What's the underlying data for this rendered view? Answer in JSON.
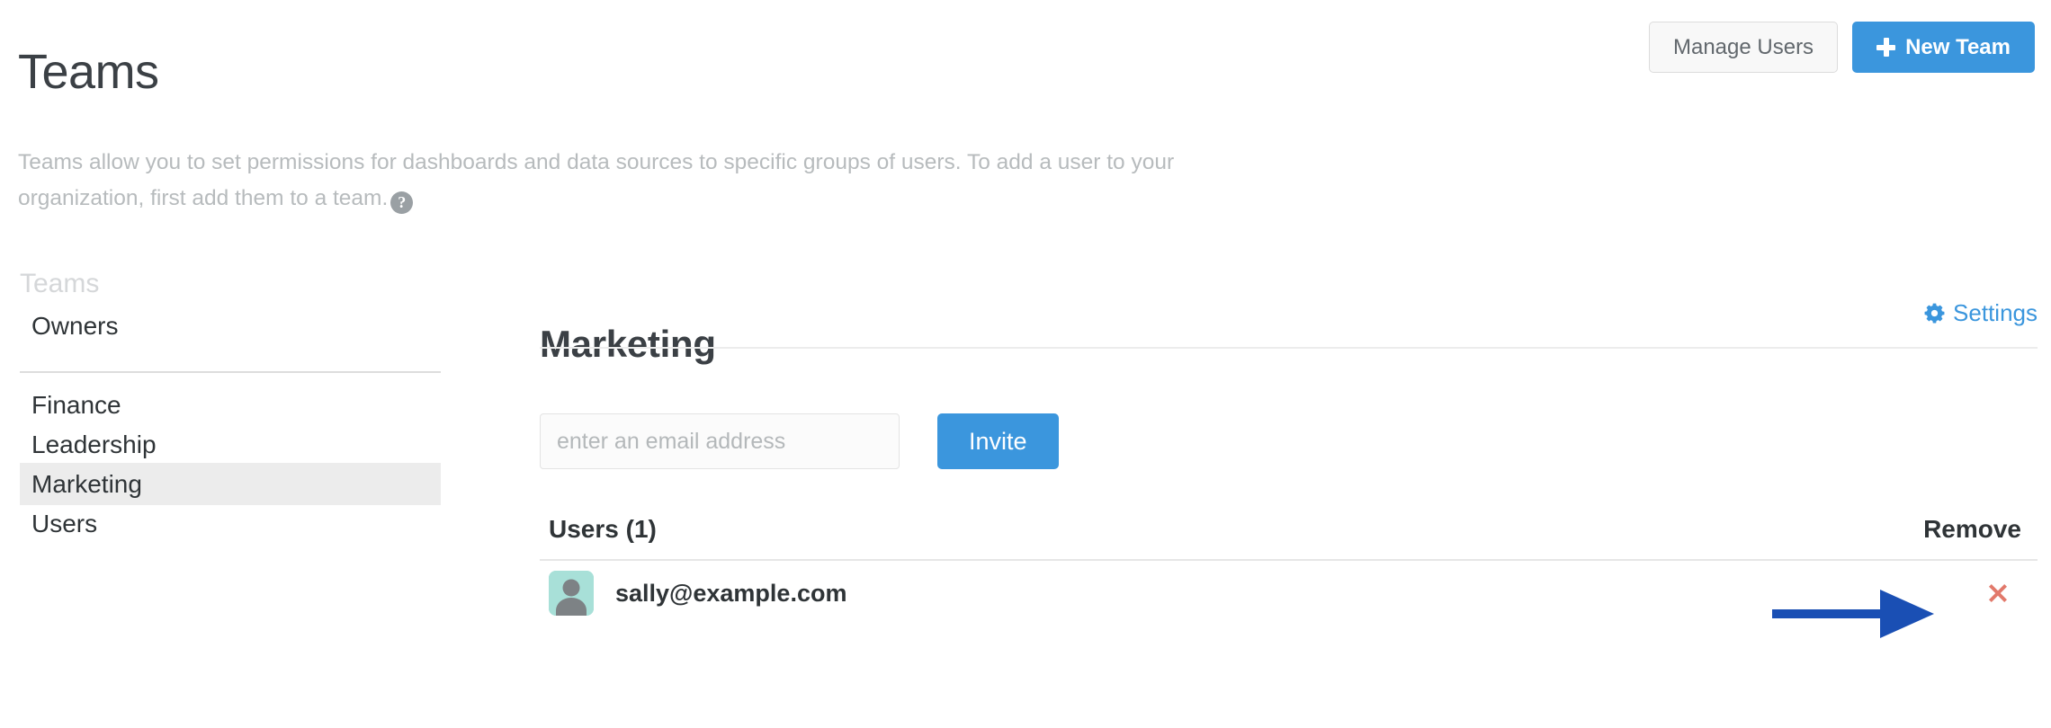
{
  "header": {
    "title": "Teams",
    "manage_users_label": "Manage Users",
    "new_team_label": "New Team",
    "plus_icon": "plus-icon"
  },
  "description": {
    "text": "Teams allow you to set permissions for dashboards and data sources to specific groups of users. To add a user to your organization, first add them to a team.",
    "help_icon_glyph": "?"
  },
  "sidebar": {
    "section_title": "Teams",
    "items": [
      {
        "label": "Owners",
        "active": false
      },
      {
        "label": "Finance",
        "active": false
      },
      {
        "label": "Leadership",
        "active": false
      },
      {
        "label": "Marketing",
        "active": true
      },
      {
        "label": "Users",
        "active": false
      }
    ]
  },
  "team_panel": {
    "name": "Marketing",
    "settings_label": "Settings",
    "settings_icon": "gear-icon",
    "invite": {
      "placeholder": "enter an email address",
      "value": "",
      "button_label": "Invite"
    },
    "users_table": {
      "count_header": "Users (1)",
      "remove_header": "Remove",
      "rows": [
        {
          "email": "sally@example.com",
          "avatar": "user-silhouette-avatar",
          "remove_icon": "remove-x-icon"
        }
      ]
    }
  },
  "colors": {
    "accent_blue": "#3b96dd",
    "remove_red": "#e2796b",
    "annotation_blue": "#1a4fb4",
    "avatar_bg": "#a8e0d8",
    "active_item_bg": "#ececec",
    "muted_text": "#b7bbbd"
  },
  "annotation": {
    "type": "arrow",
    "direction": "right",
    "points_to": "remove-user-button"
  }
}
